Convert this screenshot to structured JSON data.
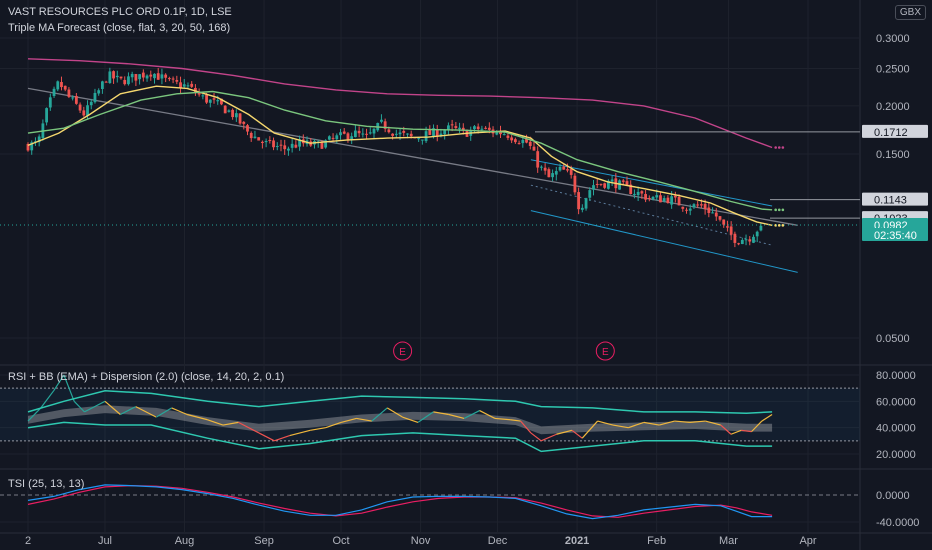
{
  "header": {
    "title": "VAST RESOURCES PLC ORD 0.1P, 1D, LSE",
    "indicator": "Triple MA Forecast (close, flat, 3, 20, 50, 168)",
    "currency": "GBX"
  },
  "colors": {
    "background": "#131722",
    "up": "#26a69a",
    "down": "#ef5350",
    "ma_fast": "#f5d76e",
    "ma_mid": "#7bc67e",
    "ma_slow": "#c2448a",
    "trend": "#787b86",
    "channel": "#2196c8",
    "grid": "#1e222d",
    "rsi": "#2ec8b0",
    "tsi": "#2196f3",
    "tsi_signal": "#e91e63"
  },
  "chart_data": [
    {
      "type": "candlestick",
      "title": "VAST RESOURCES PLC ORD 0.1P, 1D, LSE",
      "scale": "log",
      "ylim": [
        0.042,
        0.33
      ],
      "y_ticks": [
        "0.3000",
        "0.2500",
        "0.2000",
        "0.1500",
        "0.0500"
      ],
      "x_ticks": [
        "2",
        "Jul",
        "Aug",
        "Sep",
        "Oct",
        "Nov",
        "Dec",
        "2021",
        "Feb",
        "Mar",
        "Apr"
      ],
      "x_tick_days": [
        0,
        30,
        61,
        92,
        122,
        153,
        183,
        214,
        245,
        273,
        304
      ],
      "price_labels": [
        {
          "label": "0.1712",
          "value": 0.1712
        },
        {
          "label": "0.1143",
          "value": 0.1143
        },
        {
          "label": "0.1023",
          "value": 0.1023
        },
        {
          "label": "0.0982",
          "value": 0.0982
        },
        {
          "label": "02:35:40",
          "value": 0.0925
        }
      ],
      "events": [
        {
          "label": "E",
          "day": 146
        },
        {
          "label": "E",
          "day": 225
        }
      ],
      "close_path": [
        {
          "day": 0,
          "value": 0.158
        },
        {
          "day": 4,
          "value": 0.16
        },
        {
          "day": 8,
          "value": 0.2
        },
        {
          "day": 12,
          "value": 0.23
        },
        {
          "day": 16,
          "value": 0.21
        },
        {
          "day": 22,
          "value": 0.19
        },
        {
          "day": 27,
          "value": 0.215
        },
        {
          "day": 31,
          "value": 0.24
        },
        {
          "day": 36,
          "value": 0.232
        },
        {
          "day": 42,
          "value": 0.238
        },
        {
          "day": 48,
          "value": 0.245
        },
        {
          "day": 55,
          "value": 0.23
        },
        {
          "day": 62,
          "value": 0.225
        },
        {
          "day": 68,
          "value": 0.21
        },
        {
          "day": 75,
          "value": 0.2
        },
        {
          "day": 80,
          "value": 0.19
        },
        {
          "day": 86,
          "value": 0.17
        },
        {
          "day": 92,
          "value": 0.16
        },
        {
          "day": 100,
          "value": 0.155
        },
        {
          "day": 106,
          "value": 0.16
        },
        {
          "day": 113,
          "value": 0.158
        },
        {
          "day": 120,
          "value": 0.165
        },
        {
          "day": 127,
          "value": 0.17
        },
        {
          "day": 132,
          "value": 0.165
        },
        {
          "day": 138,
          "value": 0.18
        },
        {
          "day": 143,
          "value": 0.17
        },
        {
          "day": 150,
          "value": 0.165
        },
        {
          "day": 158,
          "value": 0.17
        },
        {
          "day": 165,
          "value": 0.175
        },
        {
          "day": 170,
          "value": 0.17
        },
        {
          "day": 176,
          "value": 0.175
        },
        {
          "day": 180,
          "value": 0.172
        },
        {
          "day": 186,
          "value": 0.17
        },
        {
          "day": 190,
          "value": 0.165
        },
        {
          "day": 195,
          "value": 0.16
        },
        {
          "day": 199,
          "value": 0.14
        },
        {
          "day": 203,
          "value": 0.13
        },
        {
          "day": 208,
          "value": 0.137
        },
        {
          "day": 212,
          "value": 0.13
        },
        {
          "day": 215,
          "value": 0.108
        },
        {
          "day": 220,
          "value": 0.125
        },
        {
          "day": 228,
          "value": 0.127
        },
        {
          "day": 236,
          "value": 0.12
        },
        {
          "day": 243,
          "value": 0.115
        },
        {
          "day": 250,
          "value": 0.115
        },
        {
          "day": 256,
          "value": 0.11
        },
        {
          "day": 263,
          "value": 0.11
        },
        {
          "day": 268,
          "value": 0.104
        },
        {
          "day": 272,
          "value": 0.095
        },
        {
          "day": 276,
          "value": 0.09
        },
        {
          "day": 281,
          "value": 0.091
        },
        {
          "day": 286,
          "value": 0.0982
        }
      ],
      "series": [
        {
          "key": "ma_fast",
          "values": [
            [
              0,
              0.158
            ],
            [
              12,
              0.17
            ],
            [
              24,
              0.19
            ],
            [
              36,
              0.215
            ],
            [
              50,
              0.225
            ],
            [
              62,
              0.222
            ],
            [
              74,
              0.21
            ],
            [
              86,
              0.19
            ],
            [
              96,
              0.17
            ],
            [
              110,
              0.16
            ],
            [
              124,
              0.163
            ],
            [
              140,
              0.165
            ],
            [
              156,
              0.166
            ],
            [
              172,
              0.17
            ],
            [
              186,
              0.172
            ],
            [
              196,
              0.165
            ],
            [
              204,
              0.148
            ],
            [
              214,
              0.135
            ],
            [
              226,
              0.127
            ],
            [
              240,
              0.122
            ],
            [
              254,
              0.117
            ],
            [
              266,
              0.112
            ],
            [
              276,
              0.105
            ],
            [
              284,
              0.1
            ],
            [
              290,
              0.098
            ]
          ]
        },
        {
          "key": "ma_mid",
          "values": [
            [
              0,
              0.17
            ],
            [
              14,
              0.175
            ],
            [
              28,
              0.19
            ],
            [
              44,
              0.207
            ],
            [
              58,
              0.215
            ],
            [
              72,
              0.218
            ],
            [
              86,
              0.21
            ],
            [
              100,
              0.195
            ],
            [
              116,
              0.183
            ],
            [
              132,
              0.177
            ],
            [
              150,
              0.174
            ],
            [
              170,
              0.173
            ],
            [
              186,
              0.171
            ],
            [
              200,
              0.16
            ],
            [
              214,
              0.145
            ],
            [
              230,
              0.135
            ],
            [
              246,
              0.127
            ],
            [
              260,
              0.12
            ],
            [
              274,
              0.113
            ],
            [
              286,
              0.108
            ],
            [
              290,
              0.1075
            ]
          ]
        },
        {
          "key": "ma_slow",
          "values": [
            [
              0,
              0.265
            ],
            [
              20,
              0.262
            ],
            [
              40,
              0.257
            ],
            [
              60,
              0.25
            ],
            [
              80,
              0.24
            ],
            [
              100,
              0.228
            ],
            [
              120,
              0.22
            ],
            [
              140,
              0.215
            ],
            [
              160,
              0.213
            ],
            [
              180,
              0.212
            ],
            [
              200,
              0.21
            ],
            [
              220,
              0.207
            ],
            [
              240,
              0.2
            ],
            [
              260,
              0.186
            ],
            [
              280,
              0.165
            ],
            [
              290,
              0.156
            ]
          ]
        },
        {
          "key": "trend",
          "values": [
            [
              0,
              0.222
            ],
            [
              300,
              0.098
            ]
          ]
        },
        {
          "key": "channel_upper",
          "values": [
            [
              196,
              0.145
            ],
            [
              290,
              0.11
            ]
          ]
        },
        {
          "key": "channel_lower",
          "values": [
            [
              196,
              0.107
            ],
            [
              300,
              0.074
            ]
          ]
        }
      ]
    },
    {
      "type": "line",
      "title": "RSI + BB (EMA) + Dispersion (2.0) (close, 14, 20, 2, 0.1)",
      "ylim": [
        12,
        86
      ],
      "y_ticks": [
        "80.0000",
        "60.0000",
        "40.0000",
        "20.0000"
      ],
      "tick_values": [
        80,
        60,
        40,
        20
      ],
      "levels": [
        70,
        30
      ],
      "rsi": [
        [
          0,
          45
        ],
        [
          5,
          55
        ],
        [
          10,
          68
        ],
        [
          14,
          80
        ],
        [
          18,
          60
        ],
        [
          22,
          52
        ],
        [
          30,
          60
        ],
        [
          36,
          50
        ],
        [
          42,
          56
        ],
        [
          50,
          48
        ],
        [
          56,
          55
        ],
        [
          62,
          50
        ],
        [
          70,
          46
        ],
        [
          76,
          42
        ],
        [
          82,
          44
        ],
        [
          90,
          36
        ],
        [
          96,
          30
        ],
        [
          102,
          34
        ],
        [
          110,
          38
        ],
        [
          116,
          40
        ],
        [
          122,
          44
        ],
        [
          128,
          47
        ],
        [
          134,
          45
        ],
        [
          140,
          55
        ],
        [
          146,
          48
        ],
        [
          152,
          44
        ],
        [
          158,
          52
        ],
        [
          164,
          50
        ],
        [
          170,
          47
        ],
        [
          176,
          53
        ],
        [
          182,
          47
        ],
        [
          188,
          46
        ],
        [
          192,
          45
        ],
        [
          196,
          36
        ],
        [
          200,
          30
        ],
        [
          206,
          35
        ],
        [
          212,
          38
        ],
        [
          216,
          32
        ],
        [
          222,
          45
        ],
        [
          228,
          42
        ],
        [
          234,
          40
        ],
        [
          240,
          44
        ],
        [
          246,
          42
        ],
        [
          252,
          45
        ],
        [
          258,
          44
        ],
        [
          264,
          45
        ],
        [
          270,
          42
        ],
        [
          274,
          35
        ],
        [
          278,
          38
        ],
        [
          282,
          37
        ],
        [
          286,
          45
        ],
        [
          290,
          50
        ]
      ],
      "bb_upper": [
        [
          0,
          52
        ],
        [
          14,
          60
        ],
        [
          30,
          68
        ],
        [
          48,
          66
        ],
        [
          70,
          60
        ],
        [
          90,
          56
        ],
        [
          110,
          60
        ],
        [
          130,
          64
        ],
        [
          150,
          63
        ],
        [
          170,
          62
        ],
        [
          190,
          60
        ],
        [
          200,
          56
        ],
        [
          220,
          55
        ],
        [
          240,
          52
        ],
        [
          260,
          52
        ],
        [
          280,
          51
        ],
        [
          290,
          52
        ]
      ],
      "bb_lower": [
        [
          0,
          40
        ],
        [
          14,
          44
        ],
        [
          30,
          42
        ],
        [
          48,
          42
        ],
        [
          70,
          32
        ],
        [
          90,
          24
        ],
        [
          110,
          28
        ],
        [
          130,
          34
        ],
        [
          150,
          36
        ],
        [
          170,
          34
        ],
        [
          190,
          32
        ],
        [
          200,
          22
        ],
        [
          220,
          26
        ],
        [
          240,
          30
        ],
        [
          260,
          30
        ],
        [
          280,
          26
        ],
        [
          290,
          26
        ]
      ],
      "bb_mid": [
        [
          0,
          46
        ],
        [
          14,
          51
        ],
        [
          30,
          54
        ],
        [
          50,
          52
        ],
        [
          70,
          45
        ],
        [
          90,
          40
        ],
        [
          110,
          43
        ],
        [
          130,
          47
        ],
        [
          150,
          49
        ],
        [
          170,
          48
        ],
        [
          190,
          45
        ],
        [
          200,
          38
        ],
        [
          220,
          40
        ],
        [
          240,
          41
        ],
        [
          260,
          42
        ],
        [
          280,
          40
        ],
        [
          290,
          40
        ]
      ]
    },
    {
      "type": "line",
      "title": "TSI (25, 13, 13)",
      "ylim": [
        -45,
        22
      ],
      "y_ticks": [
        "0.0000",
        "-40.0000"
      ],
      "tick_values": [
        0,
        -40
      ],
      "tsi": [
        [
          0,
          -8
        ],
        [
          10,
          -2
        ],
        [
          20,
          8
        ],
        [
          30,
          15
        ],
        [
          40,
          14
        ],
        [
          50,
          12
        ],
        [
          60,
          8
        ],
        [
          70,
          2
        ],
        [
          80,
          -5
        ],
        [
          90,
          -15
        ],
        [
          100,
          -24
        ],
        [
          110,
          -30
        ],
        [
          120,
          -30
        ],
        [
          130,
          -22
        ],
        [
          140,
          -10
        ],
        [
          150,
          -3
        ],
        [
          160,
          -2
        ],
        [
          170,
          -2
        ],
        [
          180,
          -3
        ],
        [
          190,
          -5
        ],
        [
          200,
          -16
        ],
        [
          210,
          -28
        ],
        [
          220,
          -35
        ],
        [
          230,
          -30
        ],
        [
          240,
          -22
        ],
        [
          250,
          -18
        ],
        [
          260,
          -14
        ],
        [
          270,
          -16
        ],
        [
          276,
          -24
        ],
        [
          282,
          -32
        ],
        [
          290,
          -32
        ]
      ],
      "signal": [
        [
          0,
          -14
        ],
        [
          10,
          -6
        ],
        [
          20,
          4
        ],
        [
          30,
          12
        ],
        [
          40,
          14
        ],
        [
          50,
          13
        ],
        [
          60,
          10
        ],
        [
          70,
          4
        ],
        [
          80,
          -3
        ],
        [
          90,
          -12
        ],
        [
          100,
          -20
        ],
        [
          110,
          -27
        ],
        [
          120,
          -31
        ],
        [
          130,
          -27
        ],
        [
          140,
          -18
        ],
        [
          150,
          -10
        ],
        [
          160,
          -5
        ],
        [
          170,
          -3
        ],
        [
          180,
          -3
        ],
        [
          190,
          -4
        ],
        [
          200,
          -12
        ],
        [
          210,
          -22
        ],
        [
          220,
          -31
        ],
        [
          230,
          -33
        ],
        [
          240,
          -27
        ],
        [
          250,
          -22
        ],
        [
          260,
          -17
        ],
        [
          270,
          -15
        ],
        [
          276,
          -19
        ],
        [
          282,
          -25
        ],
        [
          290,
          -30
        ]
      ]
    }
  ]
}
